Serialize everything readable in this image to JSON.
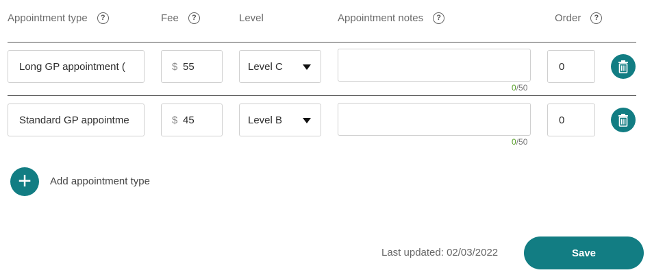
{
  "columns": {
    "appointment_type": "Appointment type",
    "fee": "Fee",
    "level": "Level",
    "notes": "Appointment notes",
    "order": "Order",
    "help_glyph": "?"
  },
  "rows": [
    {
      "type": "Long GP appointment (",
      "currency": "$",
      "fee": "55",
      "level": "Level C",
      "notes": "",
      "count_current": "0",
      "count_max": "/50",
      "order": "0"
    },
    {
      "type": "Standard GP appointme",
      "currency": "$",
      "fee": "45",
      "level": "Level B",
      "notes": "",
      "count_current": "0",
      "count_max": "/50",
      "order": "0"
    }
  ],
  "add": {
    "glyph": "+",
    "label": "Add appointment type"
  },
  "footer": {
    "last_updated": "Last updated: 02/03/2022",
    "save_label": "Save"
  },
  "colors": {
    "accent": "#127d83",
    "counter_current": "#5aa02c"
  },
  "icons": {
    "help": "help-circle-icon",
    "delete": "trash-icon",
    "dropdown": "caret-down-icon",
    "add": "plus-icon"
  }
}
